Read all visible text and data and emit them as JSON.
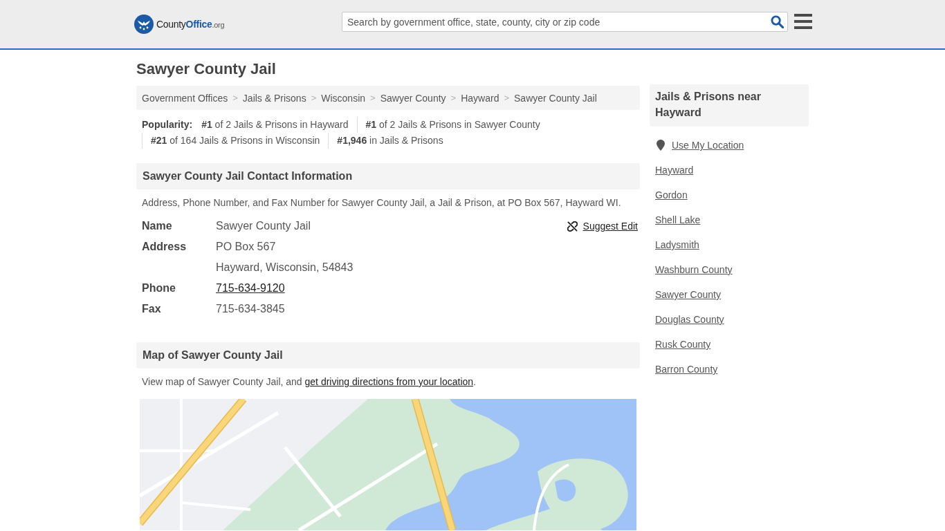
{
  "header": {
    "logo": {
      "name": "County**Office**",
      "suffix": ".org"
    },
    "search": {
      "placeholder": "Search by government office, state, county, city or zip code"
    }
  },
  "page_title": "Sawyer County Jail",
  "breadcrumb": {
    "items": [
      "Government Offices",
      "Jails & Prisons",
      "Wisconsin",
      "Sawyer County",
      "Hayward",
      "Sawyer County Jail"
    ],
    "separators": [
      ">",
      ">",
      ">",
      ">",
      ">"
    ]
  },
  "popularity": {
    "label": "Popularity:",
    "ranks": [
      "**#1** of 2 Jails & Prisons in Hayward",
      "**#1** of 2 Jails & Prisons in Sawyer County",
      "**#21** of 164 Jails & Prisons in Wisconsin",
      "**#1,946** in Jails & Prisons"
    ]
  },
  "contact": {
    "heading": "Sawyer County Jail Contact Information",
    "description": "Address, Phone Number, and Fax Number for Sawyer County Jail, a Jail & Prison, at PO Box 567, Hayward WI.",
    "suggest_edit": "Suggest Edit",
    "rows": [
      {
        "label": "Name",
        "kind": "text",
        "lines": [
          "Sawyer County Jail"
        ]
      },
      {
        "label": "Address",
        "kind": "text",
        "lines": [
          "PO Box 567",
          "Hayward, Wisconsin, 54843"
        ]
      },
      {
        "label": "Phone",
        "kind": "link",
        "lines": [
          "715-634-9120"
        ]
      },
      {
        "label": "Fax",
        "kind": "text",
        "lines": [
          "715-634-3845"
        ]
      }
    ]
  },
  "map": {
    "heading": "Map of Sawyer County Jail",
    "intro": "View map of Sawyer County Jail, and ",
    "link": "get driving directions from your location",
    "end": "."
  },
  "sidebar": {
    "heading": "Jails & Prisons near Hayward",
    "use_location": "Use My Location",
    "links": [
      "Hayward",
      "Gordon",
      "Shell Lake",
      "Ladysmith",
      "Washburn County",
      "Sawyer County",
      "Douglas County",
      "Rusk County",
      "Barron County"
    ]
  }
}
